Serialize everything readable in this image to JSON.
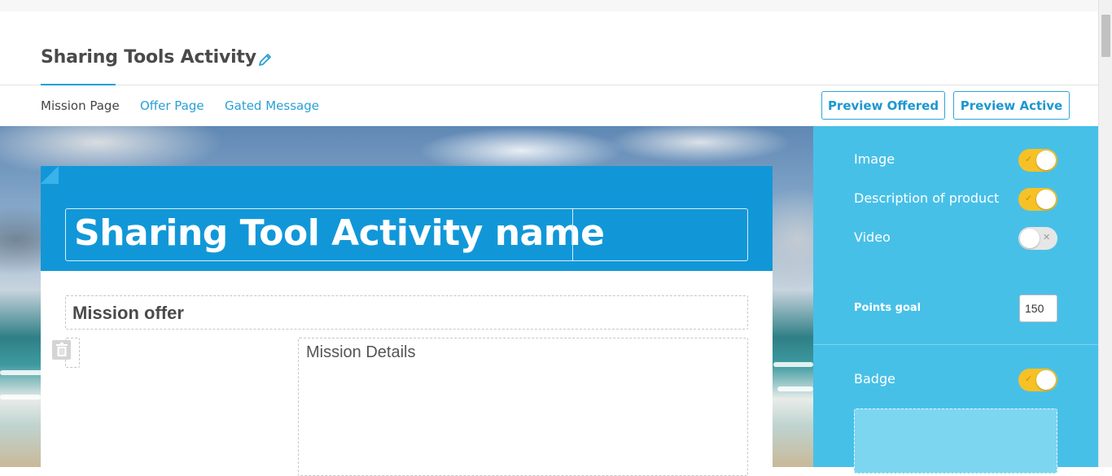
{
  "page": {
    "title": "Sharing Tools Activity"
  },
  "tabs": [
    {
      "label": "Mission Page",
      "active": true
    },
    {
      "label": "Offer Page",
      "active": false
    },
    {
      "label": "Gated Message",
      "active": false
    }
  ],
  "buttons": {
    "preview_offered": "Preview Offered",
    "preview_active": "Preview Active"
  },
  "mission": {
    "activity_name": "Sharing Tool Activity name",
    "offer_heading": "Mission offer",
    "details_placeholder": "Mission Details"
  },
  "settings": {
    "image": {
      "label": "Image",
      "enabled": true
    },
    "description": {
      "label": "Description of product",
      "enabled": true
    },
    "video": {
      "label": "Video",
      "enabled": false
    },
    "points_goal": {
      "label": "Points goal",
      "value": "150"
    },
    "badge": {
      "label": "Badge",
      "enabled": true
    }
  },
  "colors": {
    "accent": "#1b9fd8",
    "header_blue": "#1197d8",
    "panel_blue": "#47c0e8",
    "toggle_on": "#f6c126"
  },
  "icons": [
    "edit-pencil-icon",
    "trash-icon",
    "check-icon",
    "x-icon"
  ]
}
